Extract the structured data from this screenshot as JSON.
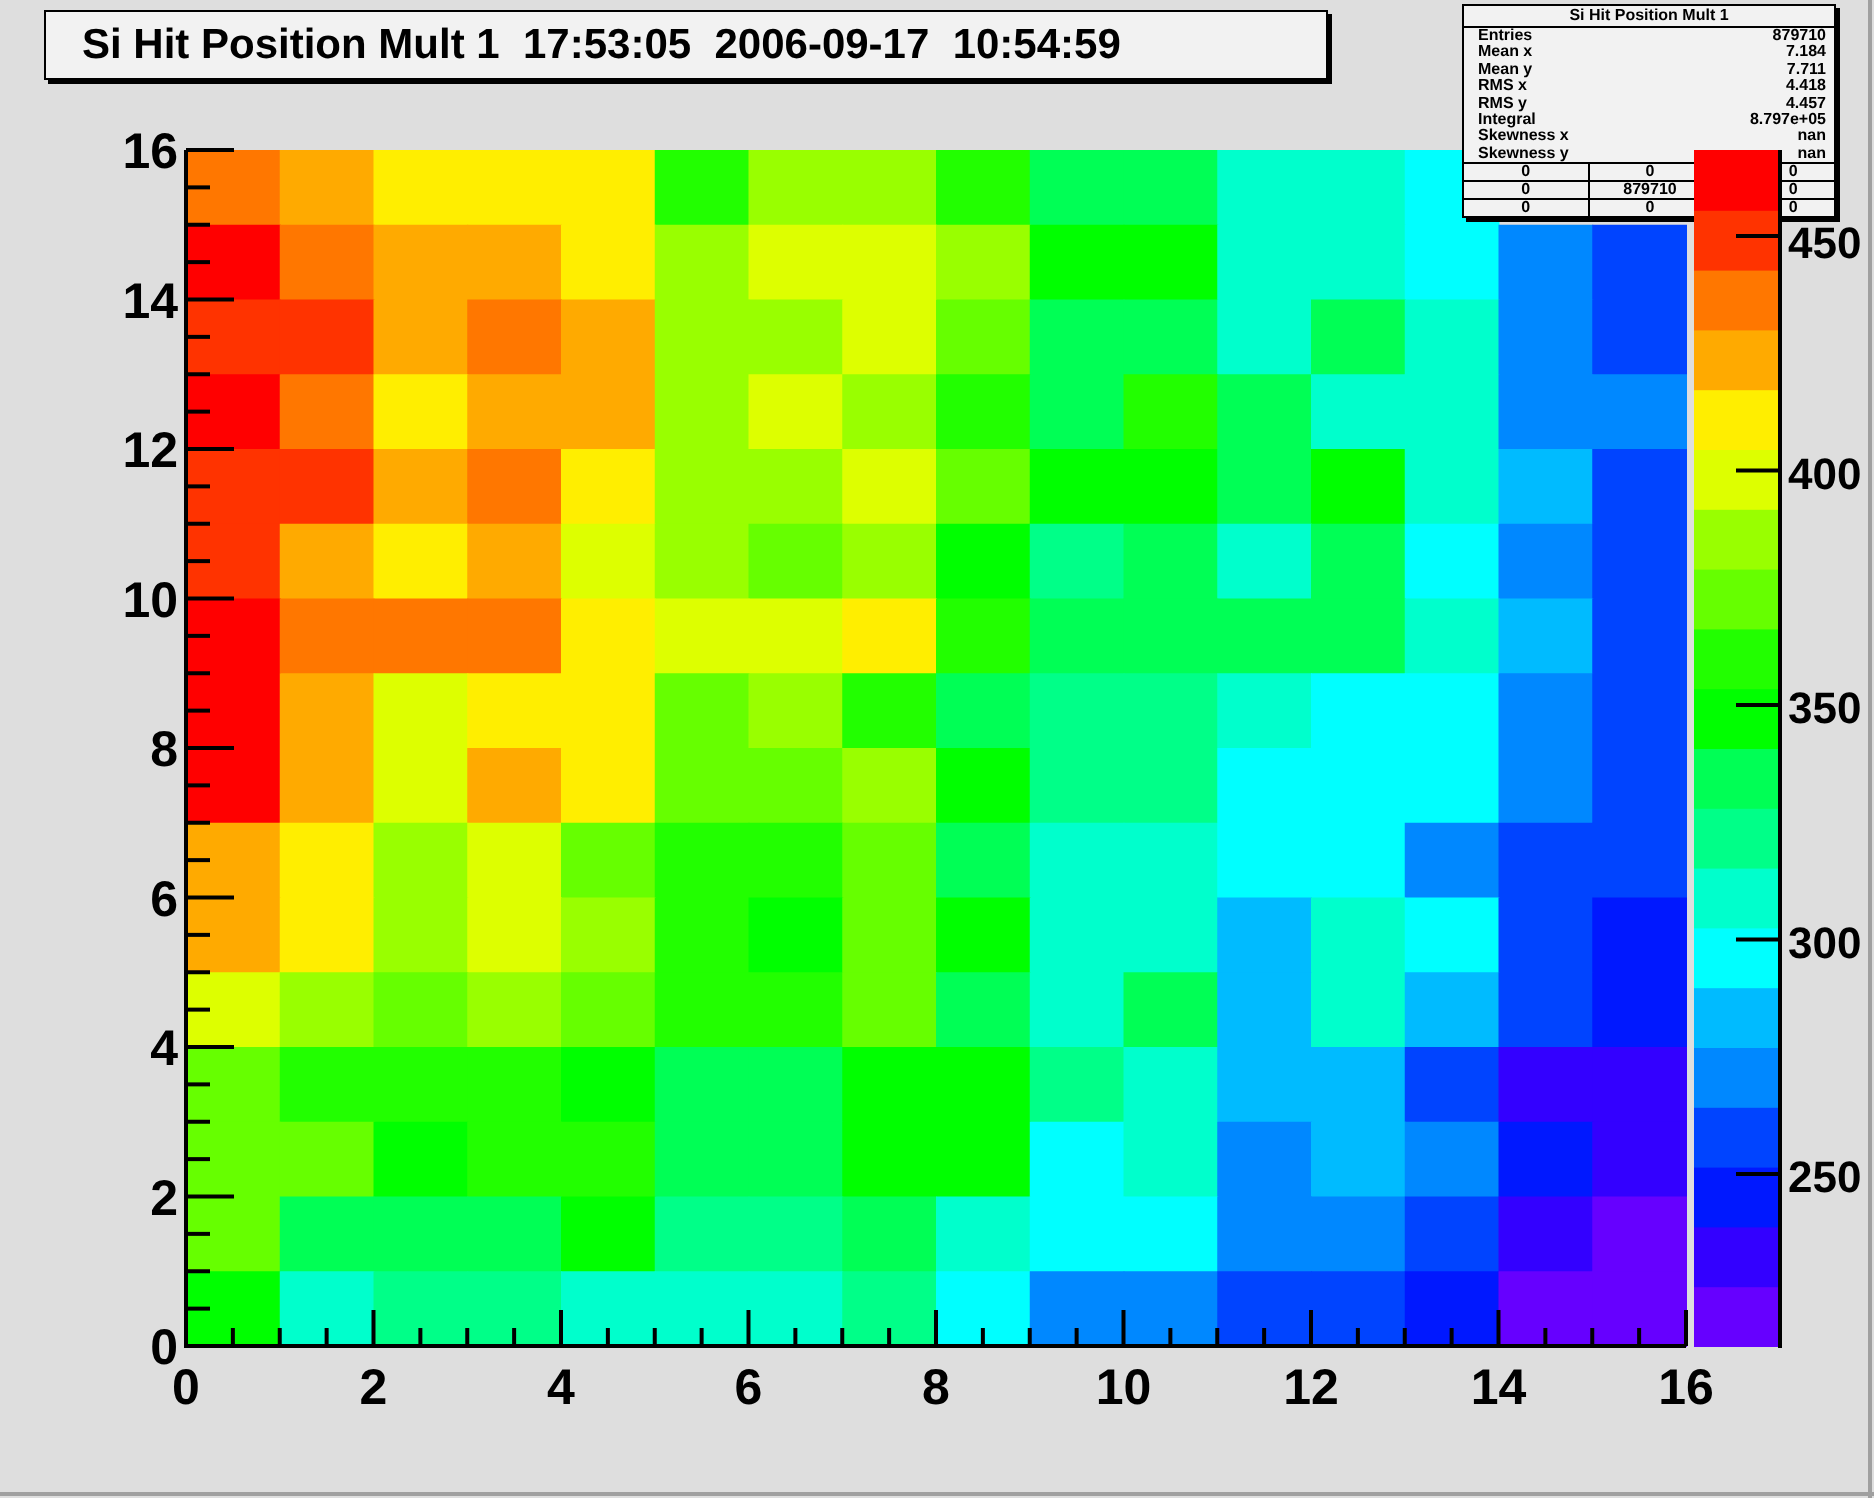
{
  "title": "Si Hit Position Mult 1  17:53:05  2006-09-17  10:54:59",
  "stats": {
    "title": "Si Hit Position Mult 1",
    "entries": [
      {
        "label": "Entries",
        "value": "879710"
      },
      {
        "label": "Mean x",
        "value": "7.184"
      },
      {
        "label": "Mean y",
        "value": "7.711"
      },
      {
        "label": "RMS x",
        "value": "4.418"
      },
      {
        "label": "RMS y",
        "value": "4.457"
      },
      {
        "label": "Integral",
        "value": "8.797e+05"
      },
      {
        "label": "Skewness x",
        "value": "nan"
      },
      {
        "label": "Skewness y",
        "value": "nan"
      }
    ],
    "grid": [
      [
        "0",
        "0",
        "0"
      ],
      [
        "0",
        "879710",
        "0"
      ],
      [
        "0",
        "0",
        "0"
      ]
    ]
  },
  "x_axis": {
    "labels": [
      "0",
      "2",
      "4",
      "6",
      "8",
      "10",
      "12",
      "14",
      "16"
    ]
  },
  "y_axis": {
    "labels": [
      "16",
      "14",
      "12",
      "10",
      "8",
      "6",
      "4",
      "2",
      "0"
    ]
  },
  "color_scale": {
    "labels": [
      "450",
      "400",
      "350",
      "300",
      "250"
    ],
    "colors": [
      {
        "color": "#6600ff"
      },
      {
        "color": "#3300ff"
      },
      {
        "color": "#0018ff"
      },
      {
        "color": "#0044ff"
      },
      {
        "color": "#0088ff"
      },
      {
        "color": "#00bbff"
      },
      {
        "color": "#00ffff"
      },
      {
        "color": "#00ffcc"
      },
      {
        "color": "#00ff88"
      },
      {
        "color": "#00ff55"
      },
      {
        "color": "#00ff00"
      },
      {
        "color": "#22ff00"
      },
      {
        "color": "#66ff00"
      },
      {
        "color": "#99ff00"
      },
      {
        "color": "#ddff00"
      },
      {
        "color": "#ffee00"
      },
      {
        "color": "#ffaa00"
      },
      {
        "color": "#ff7700"
      },
      {
        "color": "#ff3300"
      },
      {
        "color": "#ff0000"
      }
    ]
  },
  "histogram": {
    "rows": [
      {
        "cells": [
          {
            "color": "#ff7700"
          },
          {
            "color": "#ffaa00"
          },
          {
            "color": "#ffee00"
          },
          {
            "color": "#ffee00"
          },
          {
            "color": "#ffee00"
          },
          {
            "color": "#22ff00"
          },
          {
            "color": "#99ff00"
          },
          {
            "color": "#99ff00"
          },
          {
            "color": "#22ff00"
          },
          {
            "color": "#00ff55"
          },
          {
            "color": "#00ff55"
          },
          {
            "color": "#00ffcc"
          },
          {
            "color": "#00ffcc"
          },
          {
            "color": "#00ffff"
          },
          null,
          null
        ]
      },
      {
        "cells": [
          {
            "color": "#ff0000"
          },
          {
            "color": "#ff7700"
          },
          {
            "color": "#ffaa00"
          },
          {
            "color": "#ffaa00"
          },
          {
            "color": "#ffee00"
          },
          {
            "color": "#99ff00"
          },
          {
            "color": "#ddff00"
          },
          {
            "color": "#ddff00"
          },
          {
            "color": "#99ff00"
          },
          {
            "color": "#00ff00"
          },
          {
            "color": "#00ff00"
          },
          {
            "color": "#00ffcc"
          },
          {
            "color": "#00ffcc"
          },
          {
            "color": "#00ffff"
          },
          {
            "color": "#0088ff"
          },
          {
            "color": "#0044ff"
          }
        ]
      },
      {
        "cells": [
          {
            "color": "#ff3300"
          },
          {
            "color": "#ff3300"
          },
          {
            "color": "#ffaa00"
          },
          {
            "color": "#ff7700"
          },
          {
            "color": "#ffaa00"
          },
          {
            "color": "#99ff00"
          },
          {
            "color": "#99ff00"
          },
          {
            "color": "#ddff00"
          },
          {
            "color": "#66ff00"
          },
          {
            "color": "#00ff55"
          },
          {
            "color": "#00ff55"
          },
          {
            "color": "#00ffcc"
          },
          {
            "color": "#00ff55"
          },
          {
            "color": "#00ffcc"
          },
          {
            "color": "#0088ff"
          },
          {
            "color": "#0044ff"
          }
        ]
      },
      {
        "cells": [
          {
            "color": "#ff0000"
          },
          {
            "color": "#ff7700"
          },
          {
            "color": "#ffee00"
          },
          {
            "color": "#ffaa00"
          },
          {
            "color": "#ffaa00"
          },
          {
            "color": "#99ff00"
          },
          {
            "color": "#ddff00"
          },
          {
            "color": "#99ff00"
          },
          {
            "color": "#22ff00"
          },
          {
            "color": "#00ff55"
          },
          {
            "color": "#22ff00"
          },
          {
            "color": "#00ff55"
          },
          {
            "color": "#00ffcc"
          },
          {
            "color": "#00ffcc"
          },
          {
            "color": "#0088ff"
          },
          {
            "color": "#0088ff"
          }
        ]
      },
      {
        "cells": [
          {
            "color": "#ff3300"
          },
          {
            "color": "#ff3300"
          },
          {
            "color": "#ffaa00"
          },
          {
            "color": "#ff7700"
          },
          {
            "color": "#ffee00"
          },
          {
            "color": "#99ff00"
          },
          {
            "color": "#99ff00"
          },
          {
            "color": "#ddff00"
          },
          {
            "color": "#66ff00"
          },
          {
            "color": "#00ff00"
          },
          {
            "color": "#00ff00"
          },
          {
            "color": "#00ff55"
          },
          {
            "color": "#00ff00"
          },
          {
            "color": "#00ffcc"
          },
          {
            "color": "#00bbff"
          },
          {
            "color": "#0044ff"
          }
        ]
      },
      {
        "cells": [
          {
            "color": "#ff3300"
          },
          {
            "color": "#ffaa00"
          },
          {
            "color": "#ffee00"
          },
          {
            "color": "#ffaa00"
          },
          {
            "color": "#ddff00"
          },
          {
            "color": "#99ff00"
          },
          {
            "color": "#66ff00"
          },
          {
            "color": "#99ff00"
          },
          {
            "color": "#00ff00"
          },
          {
            "color": "#00ff88"
          },
          {
            "color": "#00ff55"
          },
          {
            "color": "#00ffcc"
          },
          {
            "color": "#00ff55"
          },
          {
            "color": "#00ffff"
          },
          {
            "color": "#0088ff"
          },
          {
            "color": "#0044ff"
          }
        ]
      },
      {
        "cells": [
          {
            "color": "#ff0000"
          },
          {
            "color": "#ff7700"
          },
          {
            "color": "#ff7700"
          },
          {
            "color": "#ff7700"
          },
          {
            "color": "#ffee00"
          },
          {
            "color": "#ddff00"
          },
          {
            "color": "#ddff00"
          },
          {
            "color": "#ffee00"
          },
          {
            "color": "#22ff00"
          },
          {
            "color": "#00ff55"
          },
          {
            "color": "#00ff55"
          },
          {
            "color": "#00ff55"
          },
          {
            "color": "#00ff55"
          },
          {
            "color": "#00ffcc"
          },
          {
            "color": "#00bbff"
          },
          {
            "color": "#0044ff"
          }
        ]
      },
      {
        "cells": [
          {
            "color": "#ff0000"
          },
          {
            "color": "#ffaa00"
          },
          {
            "color": "#ddff00"
          },
          {
            "color": "#ffee00"
          },
          {
            "color": "#ffee00"
          },
          {
            "color": "#66ff00"
          },
          {
            "color": "#99ff00"
          },
          {
            "color": "#22ff00"
          },
          {
            "color": "#00ff55"
          },
          {
            "color": "#00ff88"
          },
          {
            "color": "#00ff88"
          },
          {
            "color": "#00ffcc"
          },
          {
            "color": "#00ffff"
          },
          {
            "color": "#00ffff"
          },
          {
            "color": "#0088ff"
          },
          {
            "color": "#0044ff"
          }
        ]
      },
      {
        "cells": [
          {
            "color": "#ff0000"
          },
          {
            "color": "#ffaa00"
          },
          {
            "color": "#ddff00"
          },
          {
            "color": "#ffaa00"
          },
          {
            "color": "#ffee00"
          },
          {
            "color": "#66ff00"
          },
          {
            "color": "#66ff00"
          },
          {
            "color": "#99ff00"
          },
          {
            "color": "#00ff00"
          },
          {
            "color": "#00ff88"
          },
          {
            "color": "#00ff88"
          },
          {
            "color": "#00ffff"
          },
          {
            "color": "#00ffff"
          },
          {
            "color": "#00ffff"
          },
          {
            "color": "#0088ff"
          },
          {
            "color": "#0044ff"
          }
        ]
      },
      {
        "cells": [
          {
            "color": "#ffaa00"
          },
          {
            "color": "#ffee00"
          },
          {
            "color": "#99ff00"
          },
          {
            "color": "#ddff00"
          },
          {
            "color": "#66ff00"
          },
          {
            "color": "#22ff00"
          },
          {
            "color": "#22ff00"
          },
          {
            "color": "#66ff00"
          },
          {
            "color": "#00ff55"
          },
          {
            "color": "#00ffcc"
          },
          {
            "color": "#00ffcc"
          },
          {
            "color": "#00ffff"
          },
          {
            "color": "#00ffff"
          },
          {
            "color": "#0088ff"
          },
          {
            "color": "#0044ff"
          },
          {
            "color": "#0044ff"
          }
        ]
      },
      {
        "cells": [
          {
            "color": "#ffaa00"
          },
          {
            "color": "#ffee00"
          },
          {
            "color": "#99ff00"
          },
          {
            "color": "#ddff00"
          },
          {
            "color": "#99ff00"
          },
          {
            "color": "#22ff00"
          },
          {
            "color": "#00ff00"
          },
          {
            "color": "#66ff00"
          },
          {
            "color": "#00ff00"
          },
          {
            "color": "#00ffcc"
          },
          {
            "color": "#00ffcc"
          },
          {
            "color": "#00bbff"
          },
          {
            "color": "#00ffcc"
          },
          {
            "color": "#00ffff"
          },
          {
            "color": "#0044ff"
          },
          {
            "color": "#0018ff"
          }
        ]
      },
      {
        "cells": [
          {
            "color": "#ddff00"
          },
          {
            "color": "#99ff00"
          },
          {
            "color": "#66ff00"
          },
          {
            "color": "#99ff00"
          },
          {
            "color": "#66ff00"
          },
          {
            "color": "#22ff00"
          },
          {
            "color": "#22ff00"
          },
          {
            "color": "#66ff00"
          },
          {
            "color": "#00ff55"
          },
          {
            "color": "#00ffcc"
          },
          {
            "color": "#00ff55"
          },
          {
            "color": "#00bbff"
          },
          {
            "color": "#00ffcc"
          },
          {
            "color": "#00bbff"
          },
          {
            "color": "#0044ff"
          },
          {
            "color": "#0018ff"
          }
        ]
      },
      {
        "cells": [
          {
            "color": "#66ff00"
          },
          {
            "color": "#22ff00"
          },
          {
            "color": "#22ff00"
          },
          {
            "color": "#22ff00"
          },
          {
            "color": "#00ff00"
          },
          {
            "color": "#00ff55"
          },
          {
            "color": "#00ff55"
          },
          {
            "color": "#00ff00"
          },
          {
            "color": "#00ff00"
          },
          {
            "color": "#00ff88"
          },
          {
            "color": "#00ffcc"
          },
          {
            "color": "#00bbff"
          },
          {
            "color": "#00bbff"
          },
          {
            "color": "#0044ff"
          },
          {
            "color": "#3300ff"
          },
          {
            "color": "#3300ff"
          }
        ]
      },
      {
        "cells": [
          {
            "color": "#66ff00"
          },
          {
            "color": "#66ff00"
          },
          {
            "color": "#00ff00"
          },
          {
            "color": "#22ff00"
          },
          {
            "color": "#22ff00"
          },
          {
            "color": "#00ff55"
          },
          {
            "color": "#00ff55"
          },
          {
            "color": "#00ff00"
          },
          {
            "color": "#00ff00"
          },
          {
            "color": "#00ffff"
          },
          {
            "color": "#00ffcc"
          },
          {
            "color": "#0088ff"
          },
          {
            "color": "#00bbff"
          },
          {
            "color": "#0088ff"
          },
          {
            "color": "#0018ff"
          },
          {
            "color": "#3300ff"
          }
        ]
      },
      {
        "cells": [
          {
            "color": "#66ff00"
          },
          {
            "color": "#00ff55"
          },
          {
            "color": "#00ff55"
          },
          {
            "color": "#00ff55"
          },
          {
            "color": "#00ff00"
          },
          {
            "color": "#00ff88"
          },
          {
            "color": "#00ff88"
          },
          {
            "color": "#00ff55"
          },
          {
            "color": "#00ffcc"
          },
          {
            "color": "#00ffff"
          },
          {
            "color": "#00ffff"
          },
          {
            "color": "#0088ff"
          },
          {
            "color": "#0088ff"
          },
          {
            "color": "#0044ff"
          },
          {
            "color": "#3300ff"
          },
          {
            "color": "#6600ff"
          }
        ]
      },
      {
        "cells": [
          {
            "color": "#00ff00"
          },
          {
            "color": "#00ffcc"
          },
          {
            "color": "#00ff88"
          },
          {
            "color": "#00ff88"
          },
          {
            "color": "#00ffcc"
          },
          {
            "color": "#00ffcc"
          },
          {
            "color": "#00ffcc"
          },
          {
            "color": "#00ff88"
          },
          {
            "color": "#00ffff"
          },
          {
            "color": "#0088ff"
          },
          {
            "color": "#0088ff"
          },
          {
            "color": "#0044ff"
          },
          {
            "color": "#0044ff"
          },
          {
            "color": "#0018ff"
          },
          {
            "color": "#6600ff"
          },
          {
            "color": "#6600ff"
          }
        ]
      }
    ]
  }
}
